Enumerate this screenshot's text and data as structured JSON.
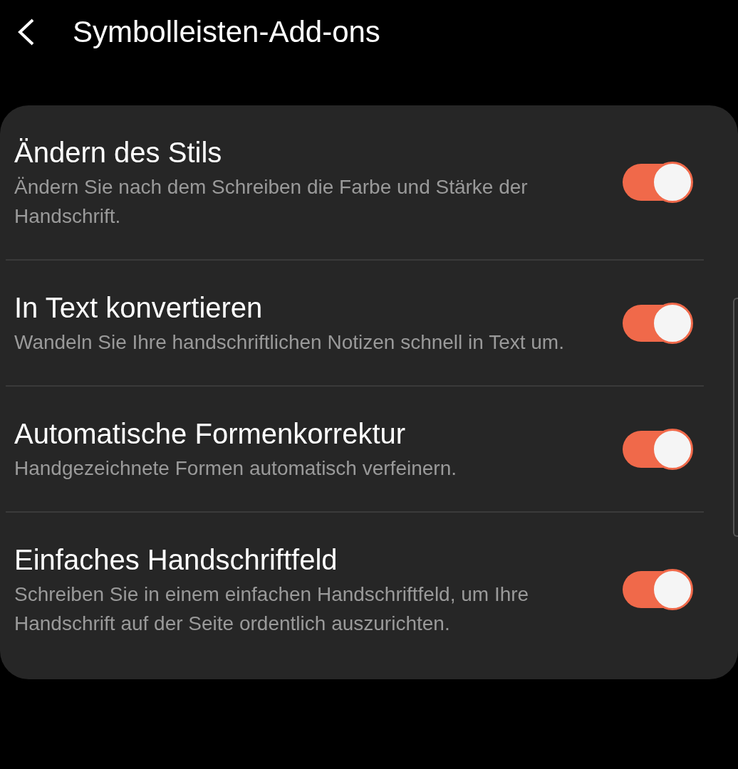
{
  "header": {
    "title": "Symbolleisten-Add-ons"
  },
  "settings": [
    {
      "title": "Ändern des Stils",
      "description": "Ändern Sie nach dem Schreiben die Farbe und Stärke der Handschrift.",
      "on": true
    },
    {
      "title": "In Text konvertieren",
      "description": "Wandeln Sie Ihre handschriftlichen Notizen schnell in Text um.",
      "on": true
    },
    {
      "title": "Automatische Formenkorrektur",
      "description": "Handgezeichnete Formen automatisch verfeinern.",
      "on": true
    },
    {
      "title": "Einfaches Handschriftfeld",
      "description": "Schreiben Sie in einem einfachen Handschriftfeld, um Ihre Handschrift auf der Seite ordentlich auszurichten.",
      "on": true
    }
  ]
}
